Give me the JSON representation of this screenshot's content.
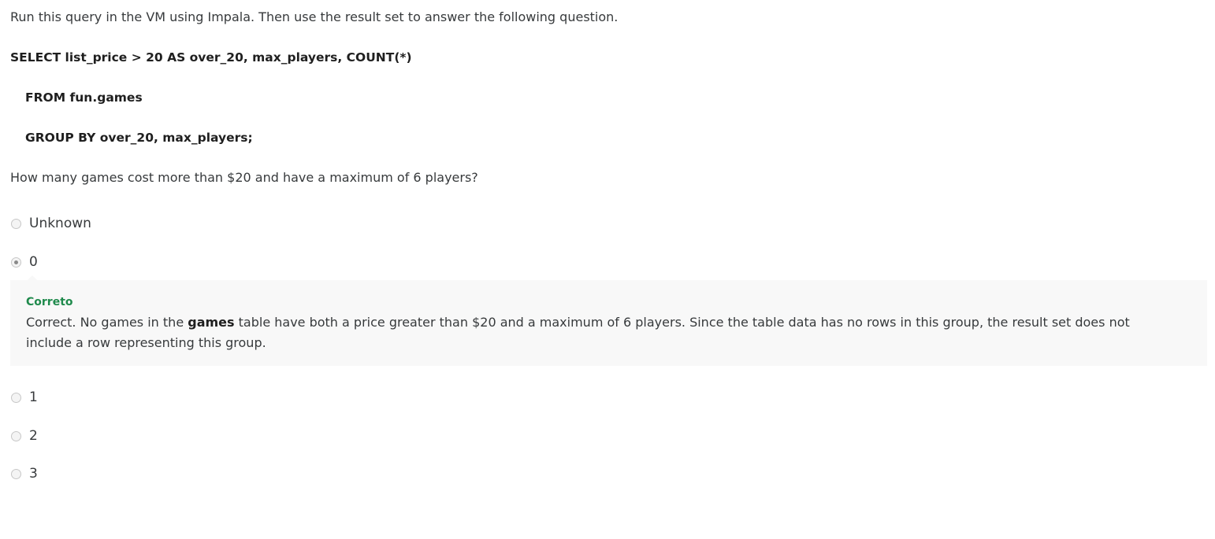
{
  "intro": "Run this query in the VM using Impala. Then use the result set to answer the following question.",
  "sql": {
    "line1": "SELECT list_price > 20 AS over_20, max_players, COUNT(*)",
    "line2": "FROM fun.games",
    "line3": "GROUP BY over_20, max_players;"
  },
  "question": "How many games cost more than $20 and have a maximum of 6 players?",
  "options": [
    {
      "label": "Unknown",
      "selected": false
    },
    {
      "label": "0",
      "selected": true
    },
    {
      "label": "1",
      "selected": false
    },
    {
      "label": "2",
      "selected": false
    },
    {
      "label": "3",
      "selected": false
    }
  ],
  "feedback": {
    "title": "Correto",
    "text_before": "Correct. No games in the ",
    "text_bold": "games",
    "text_after": " table have both a price greater than $20 and a maximum of 6 players. Since the table data has no rows in this group, the result set does not include a row representing this group."
  },
  "colors": {
    "feedback_title": "#1f8a4c",
    "feedback_background": "#f8f8f8",
    "text": "#373a3c"
  }
}
